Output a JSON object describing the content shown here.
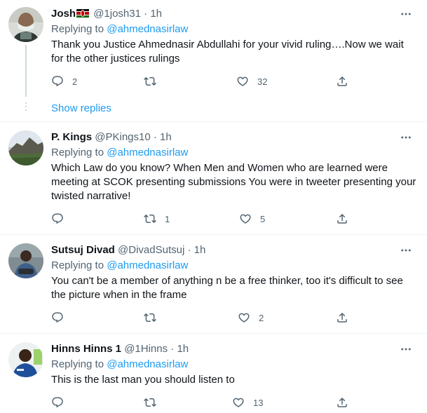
{
  "tweets": [
    {
      "name": "Josh",
      "handle": "@1josh31",
      "sep": "·",
      "time": "1h",
      "replying_label": "Replying to",
      "replying_to": "@ahmednasirlaw",
      "text": "Thank you Justice Ahmednasir Abdullahi for your vivid ruling….Now we wait for the other justices rulings",
      "replies": "2",
      "retweets": "",
      "likes": "32"
    },
    {
      "name": "P. Kings",
      "handle": "@PKings10",
      "sep": "·",
      "time": "1h",
      "replying_label": "Replying to",
      "replying_to": "@ahmednasirlaw",
      "text": "Which Law do you know? When Men and Women who are learned were meeting at SCOK presenting submissions You were in tweeter presenting your twisted narrative!",
      "replies": "",
      "retweets": "1",
      "likes": "5"
    },
    {
      "name": "Sutsuj Divad",
      "handle": "@DivadSutsuj",
      "sep": "·",
      "time": "1h",
      "replying_label": "Replying to",
      "replying_to": "@ahmednasirlaw",
      "text": "You can't be a member of anything n be a free thinker, too it's difficult to see the picture when in the frame",
      "replies": "",
      "retweets": "",
      "likes": "2"
    },
    {
      "name": "Hinns Hinns 1",
      "handle": "@1Hinns",
      "sep": "·",
      "time": "1h",
      "replying_label": "Replying to",
      "replying_to": "@ahmednasirlaw",
      "text": "This is the last man you should listen to",
      "replies": "",
      "retweets": "",
      "likes": "13"
    }
  ],
  "show_replies": "Show replies",
  "colors": {
    "link": "#1d9bf0",
    "secondary_text": "#536471",
    "primary_text": "#0f1419",
    "divider": "#eff3f4"
  },
  "icons": [
    "reply-icon",
    "retweet-icon",
    "like-icon",
    "share-icon",
    "more-icon",
    "kenya-flag-icon"
  ]
}
